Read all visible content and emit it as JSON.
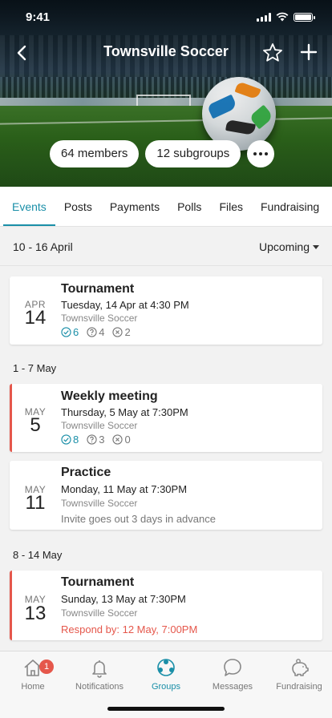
{
  "status_bar": {
    "time": "9:41"
  },
  "header": {
    "title": "Townsville Soccer",
    "members_label": "64 members",
    "subgroups_label": "12 subgroups"
  },
  "tabs": [
    {
      "label": "Events",
      "active": true
    },
    {
      "label": "Posts"
    },
    {
      "label": "Payments"
    },
    {
      "label": "Polls"
    },
    {
      "label": "Files"
    },
    {
      "label": "Fundraising"
    }
  ],
  "range": {
    "label": "10 - 16 April",
    "filter": "Upcoming"
  },
  "sections": [
    {
      "label": "1 - 7 May"
    },
    {
      "label": "8 - 14 May"
    }
  ],
  "events": [
    {
      "month": "APR",
      "day": "14",
      "title": "Tournament",
      "when": "Tuesday, 14 Apr at 4:30 PM",
      "group": "Townsville Soccer",
      "rsvp": {
        "yes": "6",
        "maybe": "4",
        "no": "2"
      }
    },
    {
      "month": "MAY",
      "day": "5",
      "title": "Weekly meeting",
      "when": "Thursday, 5 May at 7:30PM",
      "group": "Townsville Soccer",
      "rsvp": {
        "yes": "8",
        "maybe": "3",
        "no": "0"
      }
    },
    {
      "month": "MAY",
      "day": "11",
      "title": "Practice",
      "when": "Monday, 11 May at 7:30PM",
      "group": "Townsville Soccer",
      "note": "Invite goes out 3 days in advance"
    },
    {
      "month": "MAY",
      "day": "13",
      "title": "Tournament",
      "when": "Sunday, 13 May at  7:30PM",
      "group": "Townsville Soccer",
      "note": "Respond by: 12 May, 7:00PM"
    }
  ],
  "bottom_nav": [
    {
      "label": "Home",
      "icon": "home-icon",
      "badge": "1"
    },
    {
      "label": "Notifications",
      "icon": "bell-icon"
    },
    {
      "label": "Groups",
      "icon": "groups-icon",
      "active": true
    },
    {
      "label": "Messages",
      "icon": "chat-bubble-icon"
    },
    {
      "label": "Fundraising",
      "icon": "piggy-bank-icon"
    }
  ],
  "colors": {
    "accent": "#1a8fa8",
    "alert": "#e5574b"
  }
}
